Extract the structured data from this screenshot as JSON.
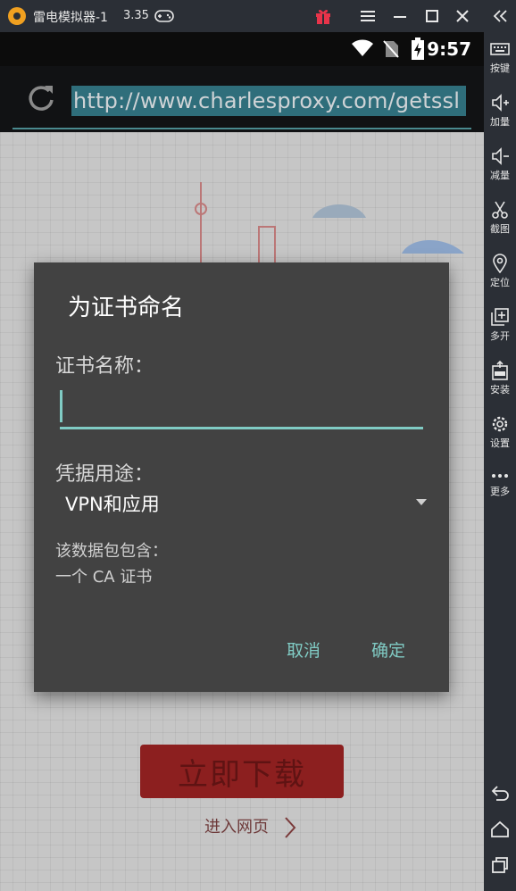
{
  "window": {
    "title": "雷电模拟器-1",
    "version": "3.35"
  },
  "statusbar": {
    "time": "9:57"
  },
  "browser": {
    "url": "http://www.charlesproxy.com/getssl"
  },
  "webpage": {
    "download_label": "立即下载",
    "enter_label": "进入网页"
  },
  "dialog": {
    "title": "为证书命名",
    "name_label": "证书名称：",
    "name_value": "",
    "usage_label": "凭据用途：",
    "usage_value": "VPN和应用",
    "info_line1": "该数据包包含：",
    "info_line2": "一个 CA 证书",
    "cancel_label": "取消",
    "ok_label": "确定"
  },
  "toolbar": {
    "items": [
      {
        "label": "按键",
        "icon": "keyboard-icon"
      },
      {
        "label": "加量",
        "icon": "volume-up-icon"
      },
      {
        "label": "减量",
        "icon": "volume-down-icon"
      },
      {
        "label": "截图",
        "icon": "scissors-icon"
      },
      {
        "label": "定位",
        "icon": "location-pin-icon"
      },
      {
        "label": "多开",
        "icon": "multi-open-icon"
      },
      {
        "label": "安装",
        "icon": "apk-install-icon"
      },
      {
        "label": "设置",
        "icon": "gear-icon"
      },
      {
        "label": "更多",
        "icon": "more-dots-icon"
      }
    ]
  },
  "colors": {
    "accent": "#80cbc4",
    "dialog_bg": "#424242",
    "chrome_bg": "#2b2f36"
  }
}
